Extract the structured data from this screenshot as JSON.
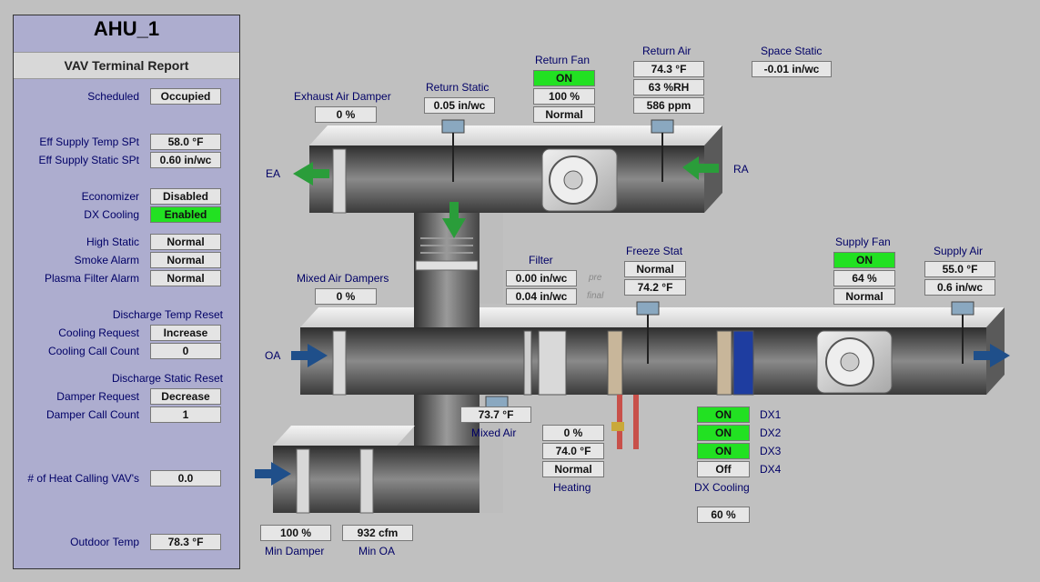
{
  "panel": {
    "title": "AHU_1",
    "subtitle": "VAV Terminal Report",
    "rows": {
      "scheduled": {
        "label": "Scheduled",
        "value": "Occupied"
      },
      "eff_supply_temp": {
        "label": "Eff Supply Temp SPt",
        "value": "58.0 °F"
      },
      "eff_supply_static": {
        "label": "Eff Supply Static SPt",
        "value": "0.60 in/wc"
      },
      "economizer": {
        "label": "Economizer",
        "value": "Disabled"
      },
      "dx_cooling": {
        "label": "DX Cooling",
        "value": "Enabled"
      },
      "high_static": {
        "label": "High Static",
        "value": "Normal"
      },
      "smoke_alarm": {
        "label": "Smoke Alarm",
        "value": "Normal"
      },
      "plasma_filter": {
        "label": "Plasma Filter Alarm",
        "value": "Normal"
      },
      "cooling_request": {
        "label": "Cooling Request",
        "value": "Increase"
      },
      "cooling_call_count": {
        "label": "Cooling Call Count",
        "value": "0"
      },
      "damper_request": {
        "label": "Damper Request",
        "value": "Decrease"
      },
      "damper_call_count": {
        "label": "Damper Call Count",
        "value": "1"
      },
      "heat_calling": {
        "label": "# of Heat Calling VAV's",
        "value": "0.0"
      },
      "outdoor_temp": {
        "label": "Outdoor Temp",
        "value": "78.3 °F"
      }
    },
    "sections": {
      "discharge_temp_reset": "Discharge Temp Reset",
      "discharge_static_reset": "Discharge Static Reset"
    }
  },
  "diagram": {
    "exhaust_damper": {
      "label": "Exhaust Air Damper",
      "value": "0 %"
    },
    "return_static": {
      "label": "Return Static",
      "value": "0.05 in/wc"
    },
    "return_fan": {
      "label": "Return Fan",
      "status": "ON",
      "speed": "100 %",
      "state": "Normal"
    },
    "return_air": {
      "label": "Return Air",
      "temp": "74.3 °F",
      "rh": "63 %RH",
      "co2": "586 ppm"
    },
    "space_static": {
      "label": "Space Static",
      "value": "-0.01 in/wc"
    },
    "ea_label": "EA",
    "ra_label": "RA",
    "oa_label": "OA",
    "mixed_dampers": {
      "label": "Mixed Air Dampers",
      "value": "0 %"
    },
    "filter": {
      "label": "Filter",
      "pre": "0.00 in/wc",
      "final": "0.04 in/wc",
      "pre_label": "pre",
      "final_label": "final"
    },
    "freeze_stat": {
      "label": "Freeze Stat",
      "state": "Normal",
      "temp": "74.2 °F"
    },
    "supply_fan": {
      "label": "Supply Fan",
      "status": "ON",
      "speed": "64 %",
      "state": "Normal"
    },
    "supply_air": {
      "label": "Supply Air",
      "temp": "55.0 °F",
      "static": "0.6 in/wc"
    },
    "mixed_air": {
      "label": "Mixed Air",
      "value": "73.7 °F"
    },
    "heating": {
      "label": "Heating",
      "valve": "0 %",
      "temp": "74.0 °F",
      "state": "Normal"
    },
    "dx": {
      "stages": [
        {
          "label": "DX1",
          "value": "ON"
        },
        {
          "label": "DX2",
          "value": "ON"
        },
        {
          "label": "DX3",
          "value": "ON"
        },
        {
          "label": "DX4",
          "value": "Off"
        }
      ],
      "label": "DX Cooling",
      "percent": "60 %"
    },
    "min_damper": {
      "label": "Min Damper",
      "value": "100 %"
    },
    "min_oa": {
      "label": "Min OA",
      "value": "932 cfm"
    }
  },
  "colors": {
    "on_green": "#22e122",
    "panel_bg": "#adadcf",
    "label_blue": "#000066",
    "arrow_green": "#2a9d3a",
    "arrow_blue": "#1f4f8a"
  }
}
